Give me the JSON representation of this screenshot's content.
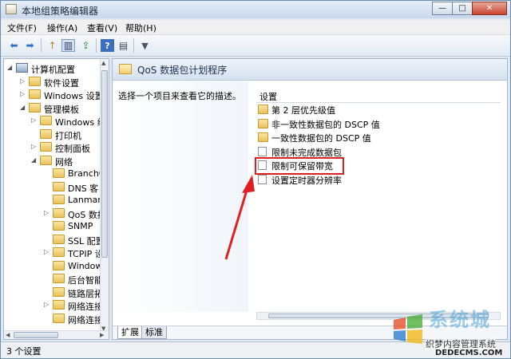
{
  "window": {
    "title": "本地组策略编辑器",
    "controls": {
      "minimize": "—",
      "maximize": "□",
      "close": "✕"
    }
  },
  "menu": [
    {
      "label": "文件(F)"
    },
    {
      "label": "操作(A)"
    },
    {
      "label": "查看(V)"
    },
    {
      "label": "帮助(H)"
    }
  ],
  "toolbar": {
    "back": "⬅",
    "forward": "➡",
    "up": "↑",
    "show_hide": "▥",
    "export": "⇪",
    "help": "?",
    "properties": "▤",
    "filter": "▼"
  },
  "tree": [
    {
      "label": "计算机配置",
      "icon": "computer-icon",
      "exp": "◢"
    },
    {
      "label": "软件设置",
      "icon": "folder-icon",
      "exp": "▷"
    },
    {
      "label": "Windows 设置",
      "icon": "folder-icon",
      "exp": "▷"
    },
    {
      "label": "管理模板",
      "icon": "folder-icon",
      "exp": "◢"
    },
    {
      "label": "Windows 组",
      "icon": "folder-icon",
      "exp": "▷"
    },
    {
      "label": "打印机",
      "icon": "folder-icon",
      "exp": ""
    },
    {
      "label": "控制面板",
      "icon": "folder-icon",
      "exp": "▷"
    },
    {
      "label": "网络",
      "icon": "folder-icon",
      "exp": "◢"
    },
    {
      "label": "BranchC",
      "icon": "folder-icon",
      "exp": ""
    },
    {
      "label": "DNS 客",
      "icon": "folder-icon",
      "exp": ""
    },
    {
      "label": "Lanman",
      "icon": "folder-icon",
      "exp": ""
    },
    {
      "label": "QoS 数据",
      "icon": "folder-icon",
      "exp": "▷"
    },
    {
      "label": "SNMP",
      "icon": "folder-icon",
      "exp": ""
    },
    {
      "label": "SSL 配置",
      "icon": "folder-icon",
      "exp": ""
    },
    {
      "label": "TCPIP 设",
      "icon": "folder-icon",
      "exp": "▷"
    },
    {
      "label": "Window",
      "icon": "folder-icon",
      "exp": ""
    },
    {
      "label": "后台智能",
      "icon": "folder-icon",
      "exp": ""
    },
    {
      "label": "链路层拓",
      "icon": "folder-icon",
      "exp": ""
    },
    {
      "label": "网络连接",
      "icon": "folder-icon",
      "exp": "▷"
    },
    {
      "label": "网络连接",
      "icon": "folder-icon",
      "exp": ""
    }
  ],
  "content": {
    "header_title": "QoS 数据包计划程序",
    "description": "选择一个项目来查看它的描述。",
    "column_header": "设置",
    "settings": [
      {
        "label": "第 2 层优先级值",
        "icon": "folder-icon"
      },
      {
        "label": "非一致性数据包的 DSCP 值",
        "icon": "folder-icon"
      },
      {
        "label": "一致性数据包的 DSCP 值",
        "icon": "folder-icon"
      },
      {
        "label": "限制未完成数据包",
        "icon": "policy-setting-icon"
      },
      {
        "label": "限制可保留带宽",
        "icon": "policy-setting-icon"
      },
      {
        "label": "设置定时器分辨率",
        "icon": "policy-setting-icon"
      }
    ]
  },
  "tabs": [
    {
      "label": "扩展"
    },
    {
      "label": "标准"
    }
  ],
  "status": {
    "text": "3 个设置"
  },
  "annotation": {
    "highlight_color": "#e02020"
  },
  "watermark": {
    "title": "系统城",
    "subtitle": "织梦内容管理系统",
    "url": "DEDECMS.COM"
  }
}
